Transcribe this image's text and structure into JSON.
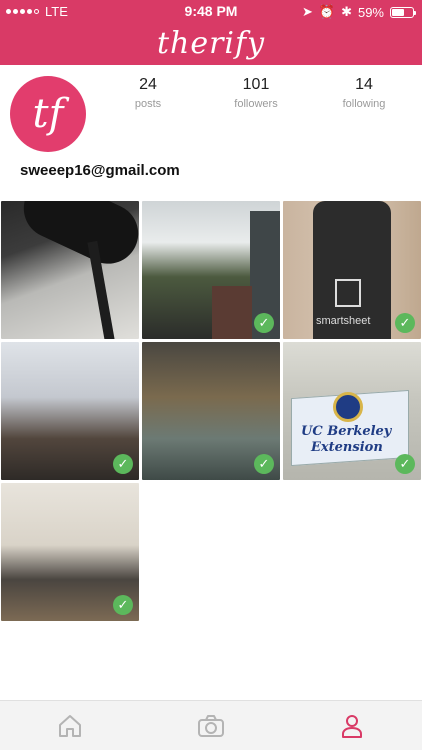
{
  "status_bar": {
    "carrier": "LTE",
    "time": "9:48 PM",
    "battery": "59%",
    "battery_level": 0.59
  },
  "header": {
    "logo": "therify",
    "accent_color": "#d93a66"
  },
  "profile": {
    "avatar_initials": "tf",
    "email": "sweeep16@gmail.com",
    "stats": [
      {
        "value": "24",
        "label": "posts"
      },
      {
        "value": "101",
        "label": "followers"
      },
      {
        "value": "14",
        "label": "following"
      }
    ]
  },
  "photos": [
    {
      "icon": "check-icon",
      "verified": false
    },
    {
      "icon": "check-icon",
      "verified": true
    },
    {
      "icon": "check-icon",
      "verified": true
    },
    {
      "icon": "check-icon",
      "verified": true
    },
    {
      "icon": "check-icon",
      "verified": true
    },
    {
      "icon": "check-icon",
      "verified": true,
      "sign_lines": [
        "UC Berkeley",
        "Extension"
      ]
    },
    {
      "icon": "check-icon",
      "verified": true
    }
  ],
  "photo_text": {
    "bottle_label": "smartsheet"
  },
  "tab_bar": {
    "tabs": [
      {
        "icon": "home-icon",
        "active": false
      },
      {
        "icon": "camera-icon",
        "active": false
      },
      {
        "icon": "profile-icon",
        "active": true
      }
    ]
  }
}
